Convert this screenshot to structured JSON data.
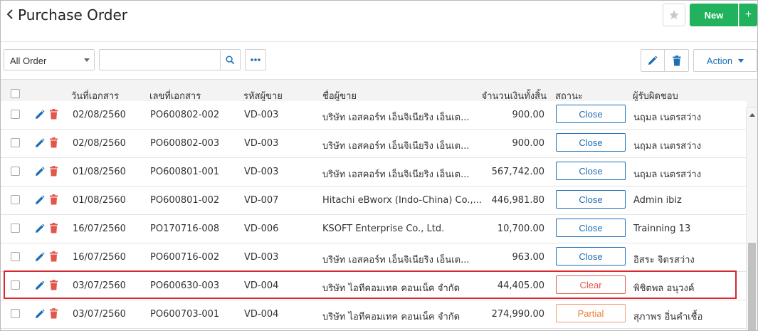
{
  "header": {
    "title": "Purchase Order",
    "new_label": "New",
    "plus_label": "+"
  },
  "toolbar": {
    "filter_selected": "All Order",
    "search_placeholder": "",
    "action_label": "Action"
  },
  "table": {
    "columns": {
      "doc_date": "วันที่เอกสาร",
      "doc_no": "เลขที่เอกสาร",
      "vendor_code": "รหัสผู้ขาย",
      "vendor_name": "ชื่อผู้ขาย",
      "total": "จำนวนเงินทั้งสิ้น",
      "status": "สถานะ",
      "owner": "ผู้รับผิดชอบ"
    },
    "rows": [
      {
        "doc_date": "02/08/2560",
        "doc_no": "PO600802-002",
        "vendor_code": "VD-003",
        "vendor_name": "บริษัท เอสคอร์ท เอ็นจิเนียริง เอ็นเต...",
        "total": "900.00",
        "status": "Close",
        "owner": "นฤมล เนตรสว่าง"
      },
      {
        "doc_date": "02/08/2560",
        "doc_no": "PO600802-003",
        "vendor_code": "VD-003",
        "vendor_name": "บริษัท เอสคอร์ท เอ็นจิเนียริง เอ็นเต...",
        "total": "900.00",
        "status": "Close",
        "owner": "นฤมล เนตรสว่าง"
      },
      {
        "doc_date": "01/08/2560",
        "doc_no": "PO600801-001",
        "vendor_code": "VD-003",
        "vendor_name": "บริษัท เอสคอร์ท เอ็นจิเนียริง เอ็นเต...",
        "total": "567,742.00",
        "status": "Close",
        "owner": "นฤมล เนตรสว่าง"
      },
      {
        "doc_date": "01/08/2560",
        "doc_no": "PO600801-002",
        "vendor_code": "VD-007",
        "vendor_name": "Hitachi eBworx (Indo-China) Co.,...",
        "total": "446,981.80",
        "status": "Close",
        "owner": "Admin ibiz"
      },
      {
        "doc_date": "16/07/2560",
        "doc_no": "PO170716-008",
        "vendor_code": "VD-006",
        "vendor_name": "KSOFT Enterprise Co., Ltd.",
        "total": "10,700.00",
        "status": "Close",
        "owner": "Trainning 13"
      },
      {
        "doc_date": "16/07/2560",
        "doc_no": "PO600716-002",
        "vendor_code": "VD-003",
        "vendor_name": "บริษัท เอสคอร์ท เอ็นจิเนียริง เอ็นเต...",
        "total": "963.00",
        "status": "Close",
        "owner": "อิสระ จิตรสว่าง"
      },
      {
        "doc_date": "03/07/2560",
        "doc_no": "PO600630-003",
        "vendor_code": "VD-004",
        "vendor_name": "บริษัท ไอทีคอมเทค คอนเน็ค จำกัด",
        "total": "44,405.00",
        "status": "Clear",
        "owner": "พิชิตพล อนุวงค์"
      },
      {
        "doc_date": "03/07/2560",
        "doc_no": "PO600703-001",
        "vendor_code": "VD-004",
        "vendor_name": "บริษัท ไอทีคอมเทค คอนเน็ค จำกัด",
        "total": "274,990.00",
        "status": "Partial",
        "owner": "สุภาพร อิ่นคำเชื้อ"
      }
    ]
  },
  "colors": {
    "brand_green": "#20b25c",
    "link_blue": "#1d6eb5",
    "delete_red": "#e2574c",
    "partial_orange": "#ed7d31",
    "highlight_red": "#d9262f"
  }
}
